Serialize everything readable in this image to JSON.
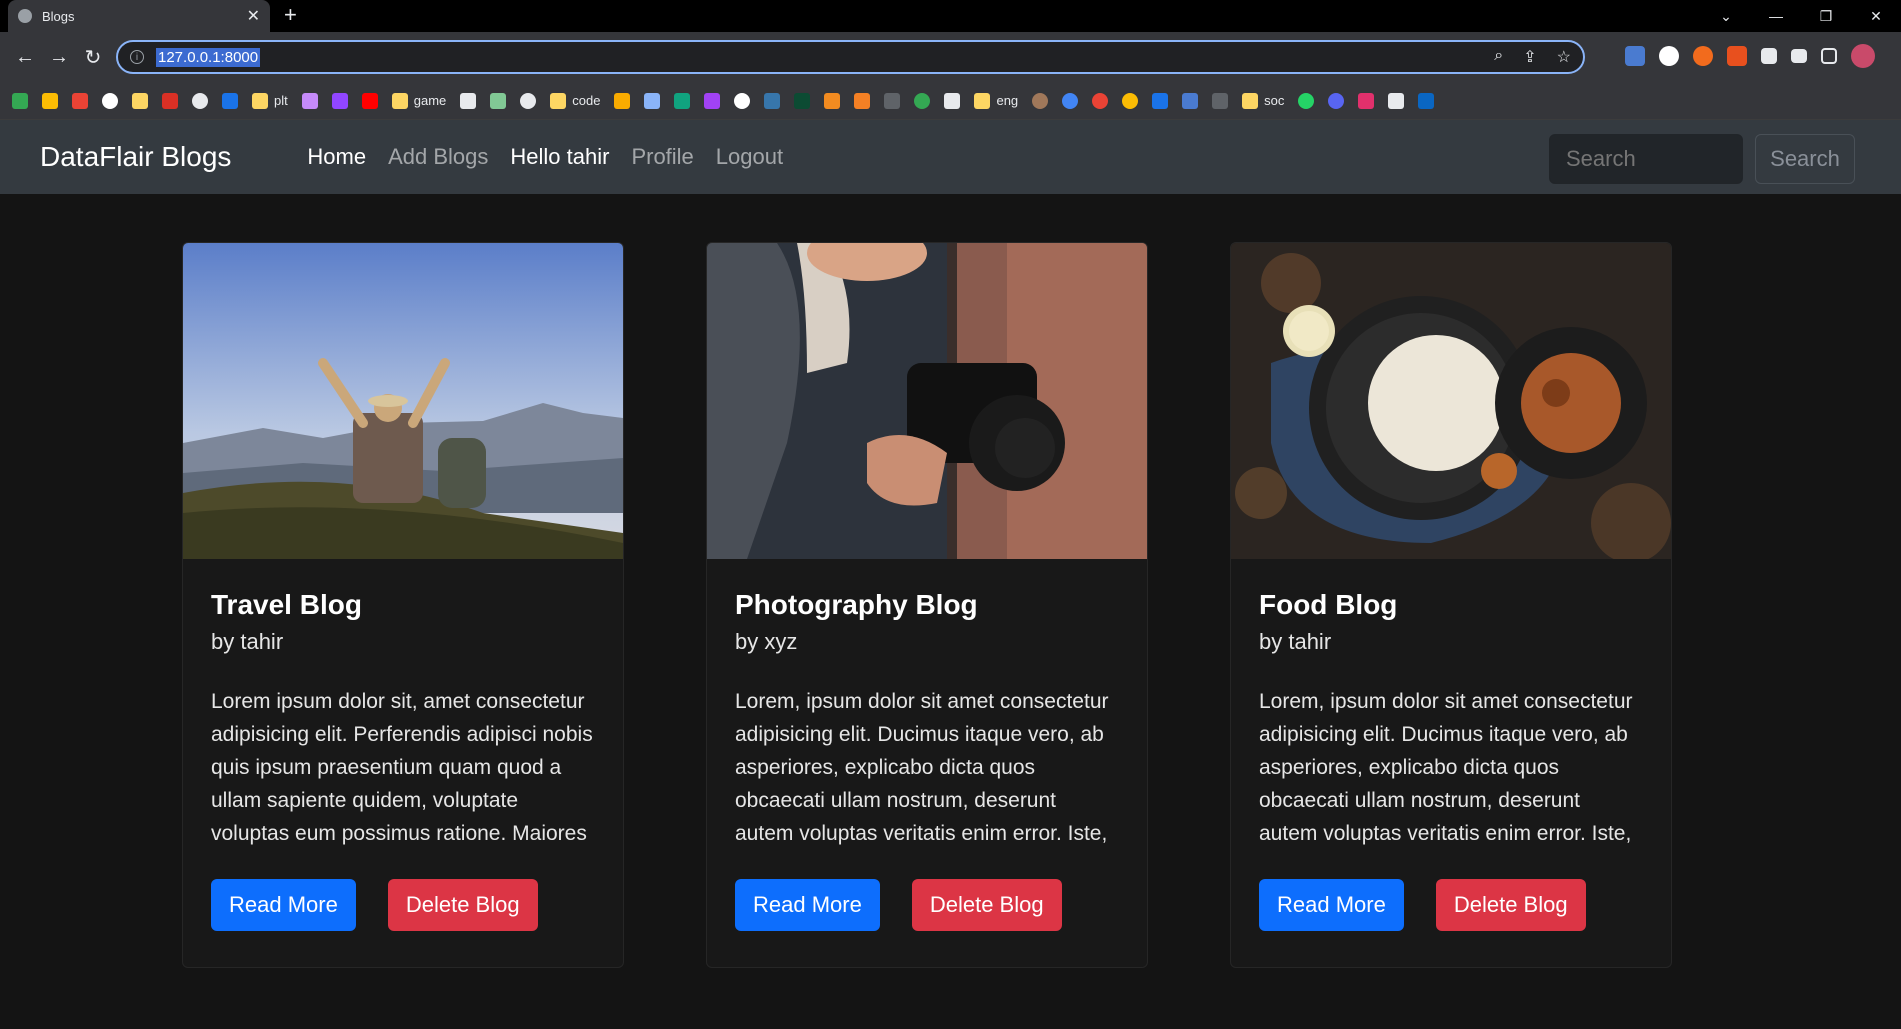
{
  "browser": {
    "tab_title": "Blogs",
    "url": "127.0.0.1:8000",
    "bookmarks": [
      "plt",
      "game",
      "code",
      "eng",
      "soc"
    ]
  },
  "site": {
    "brand": "DataFlair Blogs",
    "nav": [
      "Home",
      "Add Blogs",
      "Hello tahir",
      "Profile",
      "Logout"
    ],
    "search_placeholder": "Search",
    "search_button": "Search"
  },
  "cards": [
    {
      "title": "Travel Blog",
      "author": "by tahir",
      "text": "Lorem ipsum dolor sit, amet consectetur adipisicing elit. Perferendis adipisci nobis quis ipsum praesentium quam quod a ullam sapiente quidem, voluptate voluptas eum possimus ratione. Maiores nostrum consectet...",
      "read_more": "Read More",
      "delete": "Delete Blog"
    },
    {
      "title": "Photography Blog",
      "author": "by xyz",
      "text": "Lorem, ipsum dolor sit amet consectetur adipisicing elit. Ducimus itaque vero, ab asperiores, explicabo dicta quos obcaecati ullam nostrum, deserunt autem voluptas veritatis enim error. Iste, cupiditate adipis...",
      "read_more": "Read More",
      "delete": "Delete Blog"
    },
    {
      "title": "Food Blog",
      "author": "by tahir",
      "text": "Lorem, ipsum dolor sit amet consectetur adipisicing elit. Ducimus itaque vero, ab asperiores, explicabo dicta quos obcaecati ullam nostrum, deserunt autem voluptas veritatis enim error. Iste, cupiditate adipis...",
      "read_more": "Read More",
      "delete": "Delete Blog"
    }
  ]
}
